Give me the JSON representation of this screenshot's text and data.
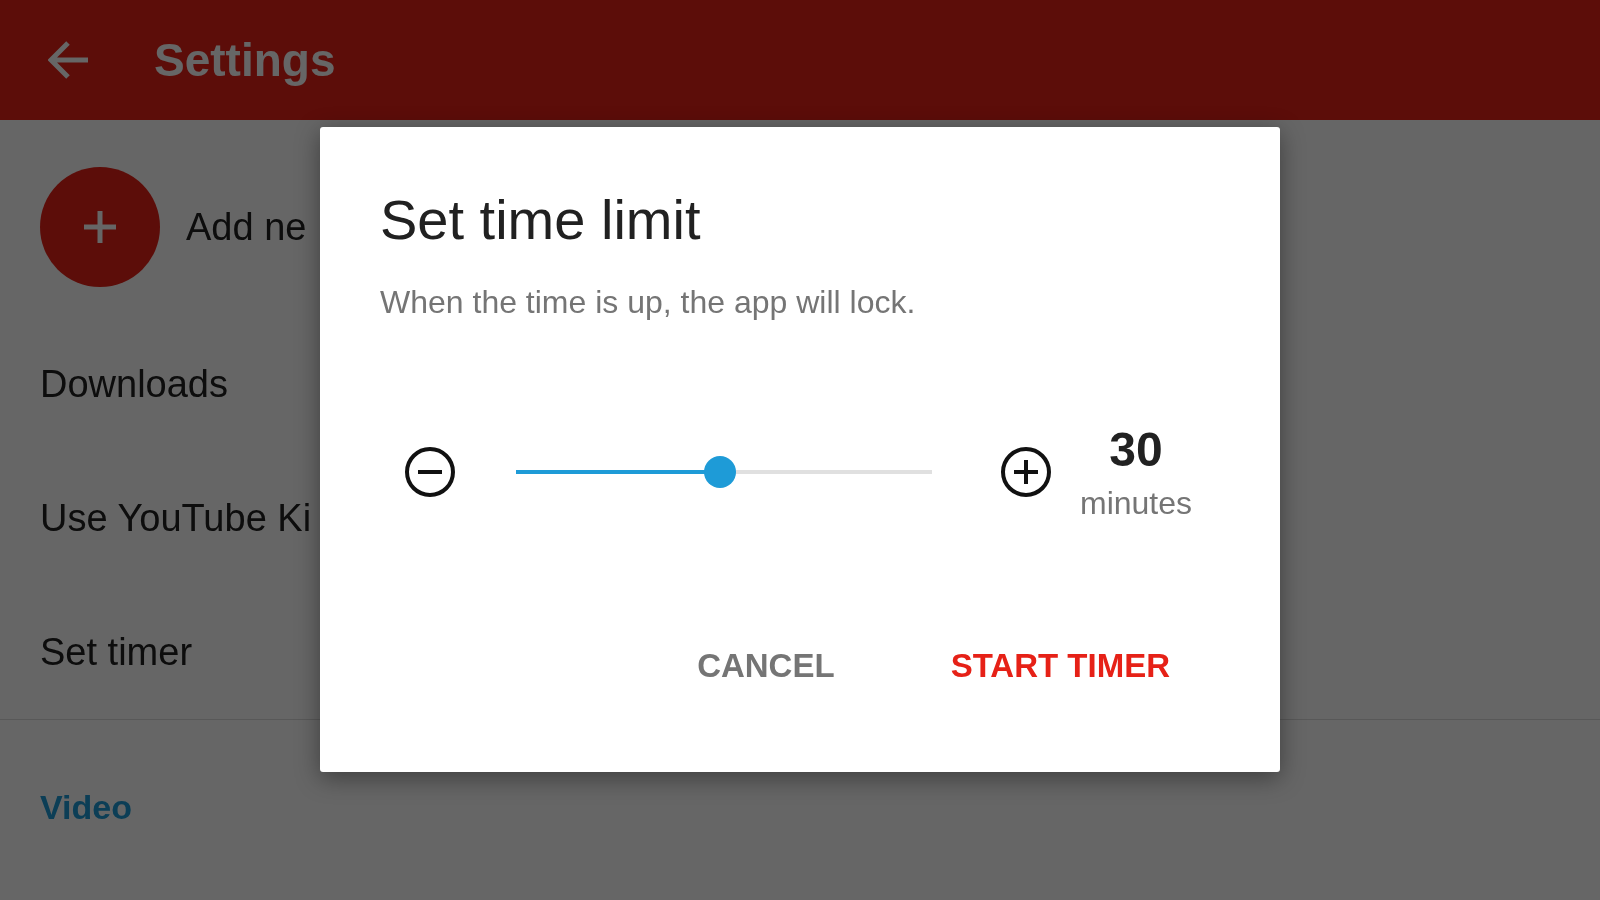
{
  "app_bar": {
    "title": "Settings"
  },
  "list": [
    {
      "kind": "add",
      "label": "Add ne"
    },
    {
      "kind": "item",
      "label": "Downloads"
    },
    {
      "kind": "item",
      "label": "Use YouTube Ki"
    },
    {
      "kind": "item",
      "label": "Set timer"
    },
    {
      "kind": "section",
      "label": "Video"
    }
  ],
  "dialog": {
    "title": "Set time limit",
    "message": "When the time is up, the app will lock.",
    "slider": {
      "level": 0.49
    },
    "value": "30",
    "unit": "minutes",
    "buttons": [
      {
        "label": "CANCEL",
        "primary": false
      },
      {
        "label": "START TIMER",
        "primary": true
      }
    ]
  }
}
